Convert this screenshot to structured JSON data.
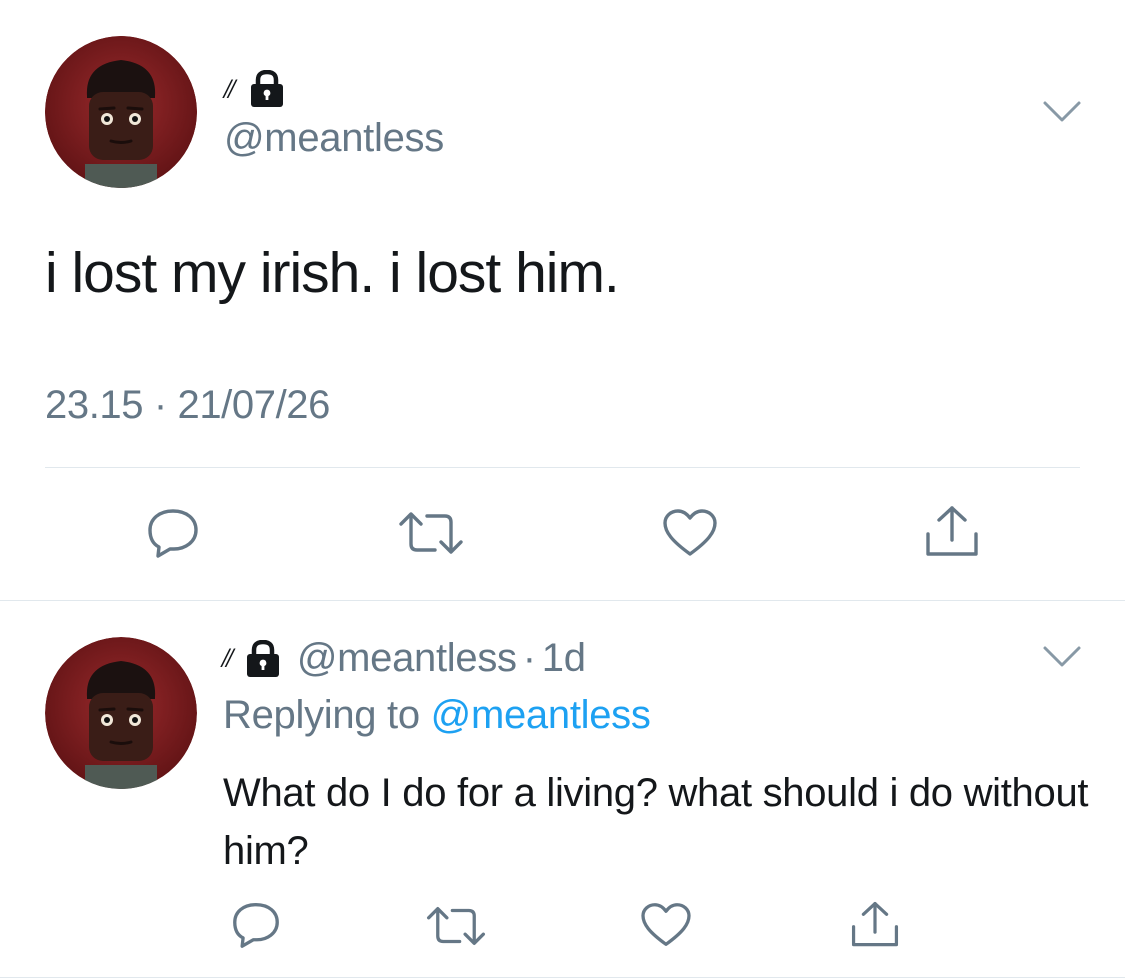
{
  "main_tweet": {
    "display_name": "//",
    "handle": "@meantless",
    "protected": true,
    "text": "i lost my irish. i lost him.",
    "time": "23.15",
    "date": "21/07/26",
    "separator": "·",
    "actions": [
      "reply-icon",
      "retweet-icon",
      "like-icon",
      "share-icon"
    ]
  },
  "reply_tweet": {
    "display_name": "//",
    "handle": "@meantless",
    "separator": "·",
    "age": "1d",
    "replying_label": "Replying to",
    "replying_to": "@meantless",
    "text": "What do I do for a living? what should i do without him?",
    "actions": [
      "reply-icon",
      "retweet-icon",
      "like-icon",
      "share-icon"
    ]
  },
  "colors": {
    "text": "#14171a",
    "secondary": "#657786",
    "link": "#1da1f2",
    "divider": "#e1e8ed",
    "icon": "#657786"
  }
}
